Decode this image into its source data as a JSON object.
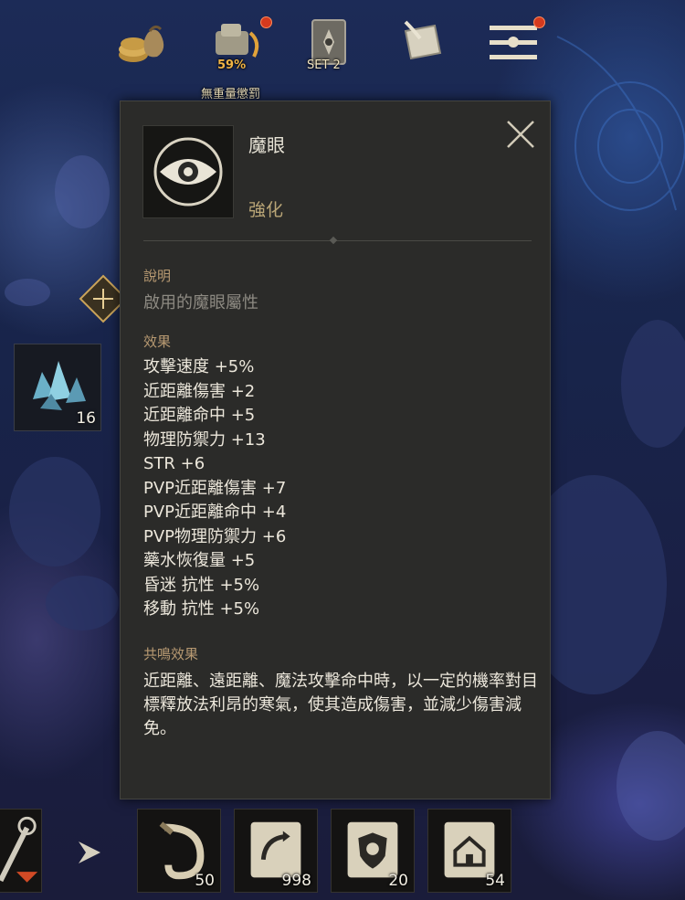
{
  "top_bar": {
    "weight_percent": "59%",
    "weight_label": "無重量懲罰",
    "set_label": "SET 2"
  },
  "item": {
    "name": "魔眼",
    "category": "強化"
  },
  "description": {
    "heading": "說明",
    "text": "啟用的魔眼屬性"
  },
  "effects": {
    "heading": "效果",
    "items": [
      "攻擊速度 +5%",
      "近距離傷害 +2",
      "近距離命中 +5",
      "物理防禦力 +13",
      "STR +6",
      "PVP近距離傷害 +7",
      "PVP近距離命中 +4",
      "PVP物理防禦力 +6",
      "藥水恢復量 +5",
      "昏迷 抗性 +5%",
      "移動 抗性 +5%"
    ]
  },
  "resonance": {
    "heading": "共鳴效果",
    "text": "近距離、遠距離、魔法攻擊命中時，以一定的機率對目標釋放法利昂的寒氣，使其造成傷害，並減少傷害減免。"
  },
  "side_slot": {
    "count": "16"
  },
  "quick_slots": [
    {
      "icon": "horn-icon",
      "count": "50"
    },
    {
      "icon": "return-scroll-icon",
      "count": "998"
    },
    {
      "icon": "shield-scroll-icon",
      "count": "20"
    },
    {
      "icon": "home-scroll-icon",
      "count": "54"
    }
  ],
  "colors": {
    "panel_bg": "#2b2b29",
    "heading": "#b89a72",
    "subtitle": "#b9a576",
    "desc": "#8d8a82",
    "text": "#ece7db",
    "weight_pct": "#f0b445",
    "notify_dot": "#d43a1e"
  }
}
